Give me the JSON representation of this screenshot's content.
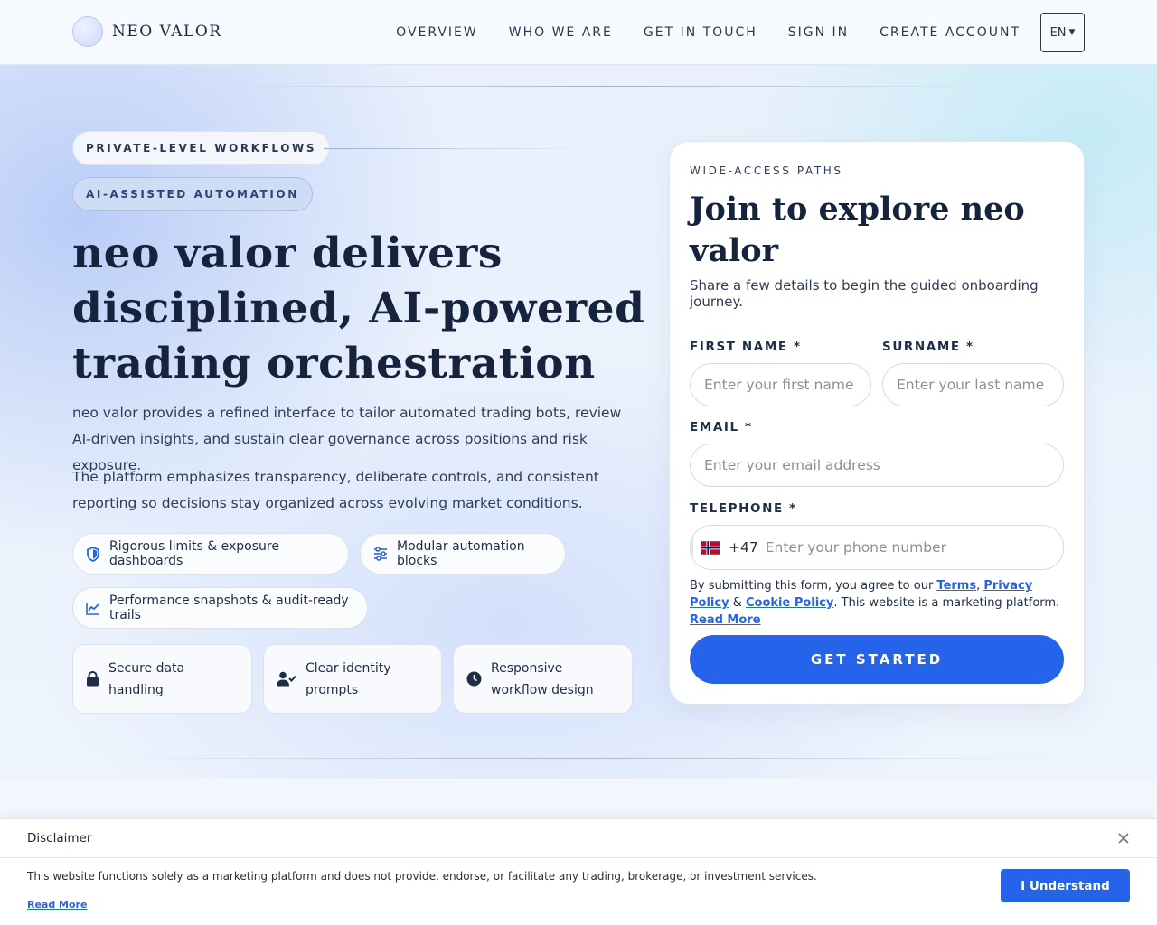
{
  "brand": {
    "name": "NEO VALOR",
    "accent": "#2563eb",
    "heading_color": "#15233d"
  },
  "nav": {
    "items": [
      "OVERVIEW",
      "WHO WE ARE",
      "GET IN TOUCH",
      "SIGN IN",
      "CREATE ACCOUNT"
    ],
    "language": "EN"
  },
  "hero": {
    "tags": [
      "PRIVATE-LEVEL WORKFLOWS",
      "AI-ASSISTED AUTOMATION"
    ],
    "headline": "neo valor delivers disciplined, AI-powered trading orchestration",
    "paragraph_1": "neo valor provides a refined interface to tailor automated trading bots, review AI-driven insights, and sustain clear governance across positions and risk exposure.",
    "paragraph_2": "The platform emphasizes transparency, deliberate controls, and consistent reporting so decisions stay organized across evolving market conditions.",
    "features": [
      {
        "label": "Rigorous limits & exposure dashboards",
        "icon": "shield-icon"
      },
      {
        "label": "Modular automation blocks",
        "icon": "sliders-icon"
      },
      {
        "label": "Performance snapshots & audit-ready trails",
        "icon": "chart-line-icon"
      }
    ],
    "highlights": [
      {
        "label": "Secure data handling",
        "icon": "lock-icon"
      },
      {
        "label": "Clear identity prompts",
        "icon": "user-check-icon"
      },
      {
        "label": "Responsive workflow design",
        "icon": "clock-icon"
      }
    ]
  },
  "form": {
    "eyebrow": "WIDE-ACCESS PATHS",
    "title": "Join to explore neo valor",
    "subtitle": "Share a few details to begin the guided onboarding journey.",
    "first_name": {
      "label": "FIRST NAME *",
      "placeholder": "Enter your first name",
      "value": ""
    },
    "surname": {
      "label": "SURNAME *",
      "placeholder": "Enter your last name",
      "value": ""
    },
    "email": {
      "label": "EMAIL *",
      "placeholder": "Enter your email address",
      "value": ""
    },
    "telephone": {
      "label": "TELEPHONE *",
      "dial_code": "+47",
      "country_flag": "norway-flag-icon",
      "placeholder": "Enter your phone number",
      "value": ""
    },
    "legal": {
      "prefix": "By submitting this form, you agree to our ",
      "terms": "Terms",
      "sep1": ", ",
      "privacy": "Privacy Policy",
      "sep2": " & ",
      "cookie": "Cookie Policy",
      "suffix": ". This website is a marketing platform. ",
      "read_more": "Read More"
    },
    "submit_label": "GET STARTED"
  },
  "disclaimer": {
    "title": "Disclaimer",
    "text": "This website functions solely as a marketing platform and does not provide, endorse, or facilitate any trading, brokerage, or investment services.",
    "read_more": "Read More",
    "button": "I Understand"
  }
}
